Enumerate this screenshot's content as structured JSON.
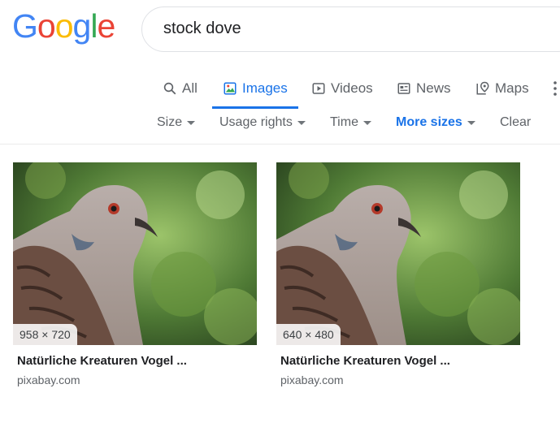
{
  "logo": {
    "letters": [
      "G",
      "o",
      "o",
      "g",
      "l",
      "e"
    ]
  },
  "search": {
    "query": "stock dove"
  },
  "tabs": [
    {
      "label": "All",
      "icon": "search-icon"
    },
    {
      "label": "Images",
      "icon": "image-icon",
      "active": true
    },
    {
      "label": "Videos",
      "icon": "play-icon"
    },
    {
      "label": "News",
      "icon": "news-icon"
    },
    {
      "label": "Maps",
      "icon": "map-pin-icon"
    }
  ],
  "tools": [
    {
      "label": "Size",
      "dropdown": true
    },
    {
      "label": "Usage rights",
      "dropdown": true
    },
    {
      "label": "Time",
      "dropdown": true
    },
    {
      "label": "More sizes",
      "dropdown": true,
      "active": true
    },
    {
      "label": "Clear",
      "dropdown": false
    }
  ],
  "results": [
    {
      "size": "958 × 720",
      "title": "Natürliche Kreaturen Vogel ...",
      "source": "pixabay.com"
    },
    {
      "size": "640 × 480",
      "title": "Natürliche Kreaturen Vogel ...",
      "source": "pixabay.com"
    }
  ],
  "colors": {
    "accent": "#1a73e8",
    "text_muted": "#5f6368"
  }
}
